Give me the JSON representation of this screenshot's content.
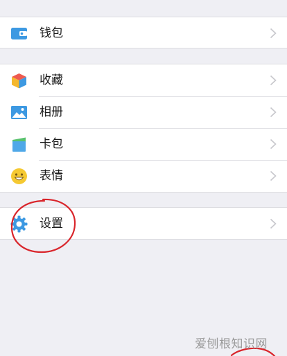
{
  "menu": {
    "group1": [
      {
        "id": "wallet",
        "label": "钱包",
        "icon": "wallet-icon"
      }
    ],
    "group2": [
      {
        "id": "favorites",
        "label": "收藏",
        "icon": "favorites-cube-icon"
      },
      {
        "id": "album",
        "label": "相册",
        "icon": "album-photo-icon"
      },
      {
        "id": "cards",
        "label": "卡包",
        "icon": "card-pack-icon"
      },
      {
        "id": "stickers",
        "label": "表情",
        "icon": "smiley-icon"
      }
    ],
    "group3": [
      {
        "id": "settings",
        "label": "设置",
        "icon": "gear-icon"
      }
    ]
  },
  "watermark": "爱刨根知识网",
  "colors": {
    "background": "#efeff4",
    "row_background": "#ffffff",
    "annotation_red": "#d9252b",
    "icon_blue": "#3d99e2",
    "smiley_yellow": "#f5c932"
  }
}
